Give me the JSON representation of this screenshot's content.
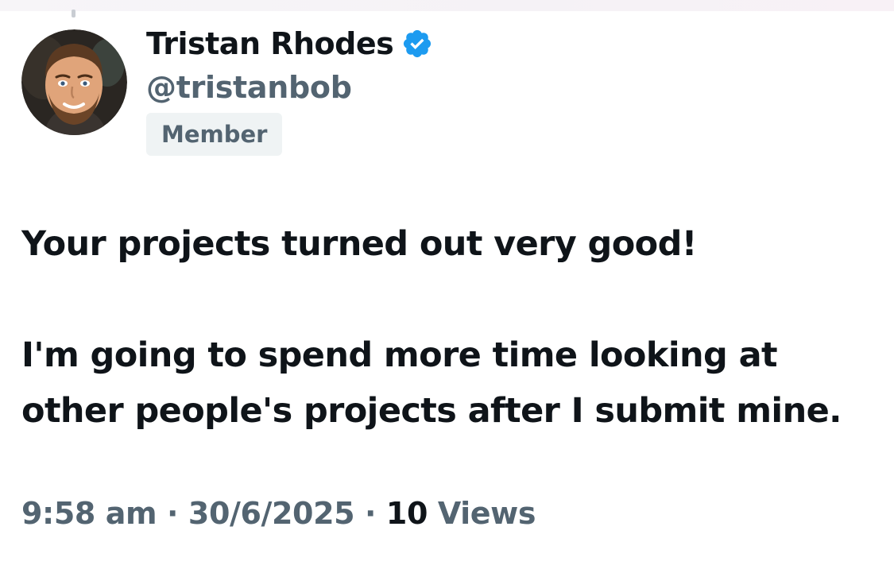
{
  "user": {
    "display_name": "Tristan Rhodes",
    "handle": "@tristanbob",
    "badge": "Member",
    "verified_icon": "verified-badge-icon",
    "verified_color": "#1d9bf0"
  },
  "tweet": {
    "lines": [
      "Your projects turned out very good!",
      "",
      "I'm going to spend more time looking at",
      "other people's projects after I submit mine."
    ]
  },
  "meta": {
    "time": "9:58 am",
    "separator": "·",
    "date": "30/6/2025",
    "views_count": "10",
    "views_label": "Views"
  },
  "colors": {
    "text_primary": "#0f1419",
    "text_secondary": "#536471",
    "badge_bg": "#eff3f4"
  }
}
